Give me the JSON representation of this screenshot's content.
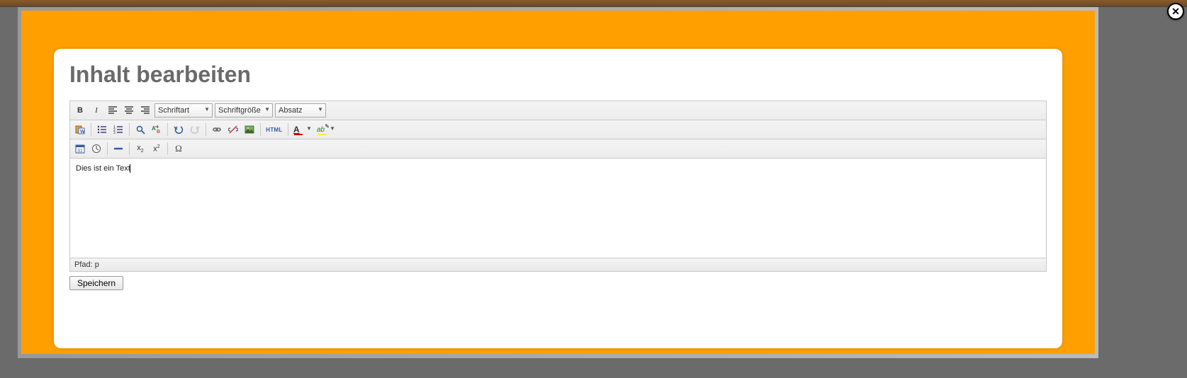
{
  "modal": {
    "close": "✕"
  },
  "heading": "Inhalt bearbeiten",
  "toolbar": {
    "font_family_label": "Schriftart",
    "font_size_label": "Schriftgröße",
    "block_format_label": "Absatz",
    "html_label": "HTML"
  },
  "content": {
    "text": "Dies ist ein Text"
  },
  "status": {
    "path": "Pfad: p"
  },
  "actions": {
    "save": "Speichern"
  }
}
